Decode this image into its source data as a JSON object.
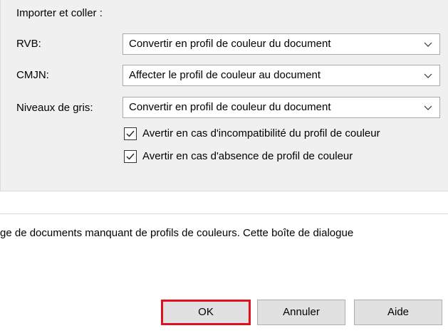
{
  "group": {
    "title": "Importer et coller :"
  },
  "fields": [
    {
      "label": "RVB:",
      "value": "Convertir en profil de couleur du document"
    },
    {
      "label": "CMJN:",
      "value": "Affecter le profil de couleur au document"
    },
    {
      "label": "Niveaux de gris:",
      "value": "Convertir en profil de couleur du document"
    }
  ],
  "checkboxes": [
    {
      "label": "Avertir en cas d'incompatibilité du profil de couleur",
      "checked": true
    },
    {
      "label": "Avertir en cas d'absence de profil de couleur",
      "checked": true
    }
  ],
  "description": {
    "text": "ge de documents manquant de profils de couleurs. Cette boîte de dialogue"
  },
  "buttons": {
    "ok": "OK",
    "cancel": "Annuler",
    "help": "Aide"
  },
  "colors": {
    "highlight": "#e01020",
    "panel": "#f0f0f0"
  }
}
